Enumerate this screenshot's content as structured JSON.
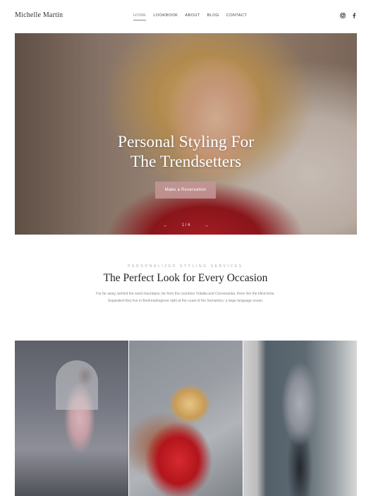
{
  "header": {
    "brand": "Michelle Martin",
    "nav": [
      "HOME",
      "LOOKBOOK",
      "ABOUT",
      "BLOG",
      "CONTACT"
    ],
    "active_nav": "HOME",
    "social": [
      "instagram-icon",
      "facebook-icon"
    ]
  },
  "hero": {
    "title_line1": "Personal Styling For",
    "title_line2": "The Trendsetters",
    "cta": "Make a Reservation",
    "slide_indicator": "1 / 4",
    "prev": "←",
    "next": "→"
  },
  "section": {
    "eyebrow": "Personalized Styling Services",
    "title": "The Perfect Look for Every Occasion",
    "description": "Far far away, behind the word mountains, far from the countries Vokalia and Consonantia, there live the blind texts. Separated they live in Bookmarksgrove right at the coast of the Semantics, a large language ocean."
  },
  "colors": {
    "accent": "#c49696",
    "text_dark": "#222222",
    "text_muted": "#8a8a8a"
  }
}
